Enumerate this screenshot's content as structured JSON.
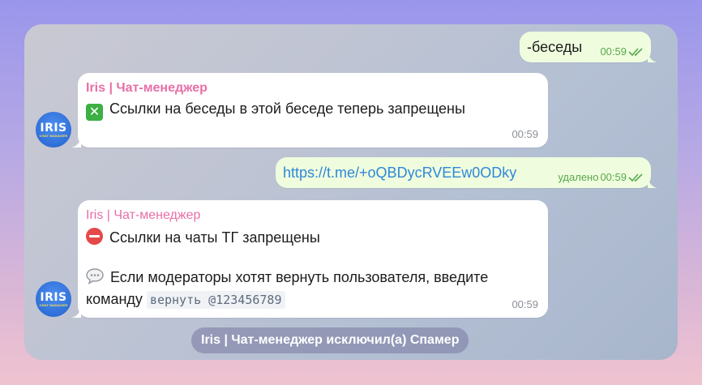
{
  "chat": {
    "messages": [
      {
        "direction": "out",
        "text": "-беседы",
        "time": "00:59"
      },
      {
        "direction": "in",
        "sender": "Iris | Чат-менеджер",
        "emoji": "cross-mark",
        "text": "Ссылки на беседы в этой беседе теперь запрещены",
        "time": "00:59"
      },
      {
        "direction": "out",
        "text": "https://t.me/+oQBDycRVEEw0ODky",
        "status": "удалено",
        "time": "00:59"
      },
      {
        "direction": "in",
        "sender": "Iris | Чат-менеджер",
        "line1_emoji": "no-entry",
        "line1": "Ссылки на чаты ТГ запрещены",
        "line2_emoji": "speech-balloon",
        "line2": "Если модераторы хотят вернуть пользователя, введите",
        "line3": "команду",
        "code": "вернуть @123456789",
        "time": "00:59"
      }
    ],
    "service_message": "Iris | Чат-менеджер исключил(а) Спамер"
  },
  "avatar": {
    "title": "IRIS",
    "subtitle": "CHAT MANAGER"
  },
  "colors": {
    "sender_name": "#e86fa6",
    "outgoing_bubble": "#effdde",
    "incoming_bubble": "#ffffff",
    "outgoing_time": "#5aa84f",
    "link": "#2f88d8"
  }
}
